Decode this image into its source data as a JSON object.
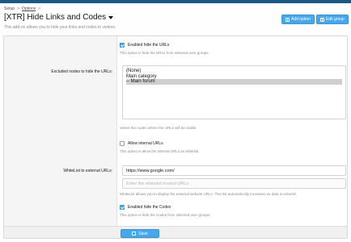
{
  "breadcrumb": {
    "items": [
      "Setup",
      "Options"
    ],
    "separator": ">"
  },
  "header": {
    "title": "[XTR] Hide Links and Codes",
    "description": "This add-on allows you to hide your links and codes to visitors.",
    "add_option_label": "Add option",
    "edit_group_label": "Edit group"
  },
  "options": {
    "hide_urls": {
      "label": "Enabled hide the URLs",
      "checked": true,
      "hint": "This option is hide the URLs from selected user groups."
    },
    "excluded_nodes": {
      "label": "Excluded nodes to hide the URLs:",
      "items": [
        "(None)",
        "Main category",
        "-- Main forum"
      ],
      "selected": "-- Main forum",
      "hint": "Select the nodes where the URLs will be visible."
    },
    "internal_urls": {
      "label": "Allow internal URLs",
      "checked": false,
      "hint": "This option is allow the internal URLs as whitelist."
    },
    "whitelist": {
      "label": "WhiteList to external URLs:",
      "value": "https://www.google.com/",
      "placeholder": "Enter the whitelist trusted URLs",
      "hint": "WhiteList allows you to display the external website URLs. This list automatically increases as data is entered."
    },
    "hide_codes": {
      "label": "Enabled hide the Codes",
      "checked": true,
      "hint": "This option is hide the Codes from selected user groups."
    }
  },
  "footer": {
    "save_label": "Save"
  },
  "colors": {
    "accent": "#47a7eb",
    "top_bar": "#185886",
    "label_column": "#f5f5f5"
  }
}
